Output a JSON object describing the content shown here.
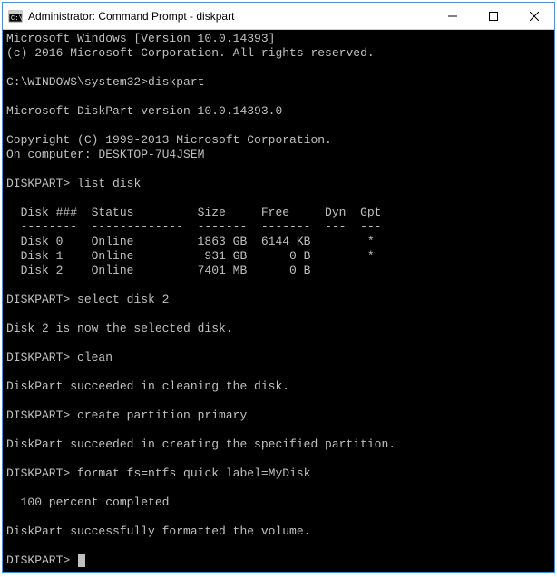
{
  "titlebar": {
    "title": "Administrator: Command Prompt - diskpart"
  },
  "terminal": {
    "header1": "Microsoft Windows [Version 10.0.14393]",
    "header2": "(c) 2016 Microsoft Corporation. All rights reserved.",
    "prompt_path": "C:\\WINDOWS\\system32>",
    "cmd_diskpart": "diskpart",
    "dp_version": "Microsoft DiskPart version 10.0.14393.0",
    "dp_copyright": "Copyright (C) 1999-2013 Microsoft Corporation.",
    "dp_computer": "On computer: DESKTOP-7U4JSEM",
    "dp_prompt": "DISKPART>",
    "cmd_listdisk": "list disk",
    "table": {
      "header": "  Disk ###  Status         Size     Free     Dyn  Gpt",
      "divider": "  --------  -------------  -------  -------  ---  ---",
      "rows": [
        "  Disk 0    Online         1863 GB  6144 KB        *",
        "  Disk 1    Online          931 GB      0 B        *",
        "  Disk 2    Online         7401 MB      0 B"
      ]
    },
    "cmd_select": "select disk 2",
    "msg_selected": "Disk 2 is now the selected disk.",
    "cmd_clean": "clean",
    "msg_cleaned": "DiskPart succeeded in cleaning the disk.",
    "cmd_create": "create partition primary",
    "msg_created": "DiskPart succeeded in creating the specified partition.",
    "cmd_format": "format fs=ntfs quick label=MyDisk",
    "msg_progress": "  100 percent completed",
    "msg_formatted": "DiskPart successfully formatted the volume."
  }
}
